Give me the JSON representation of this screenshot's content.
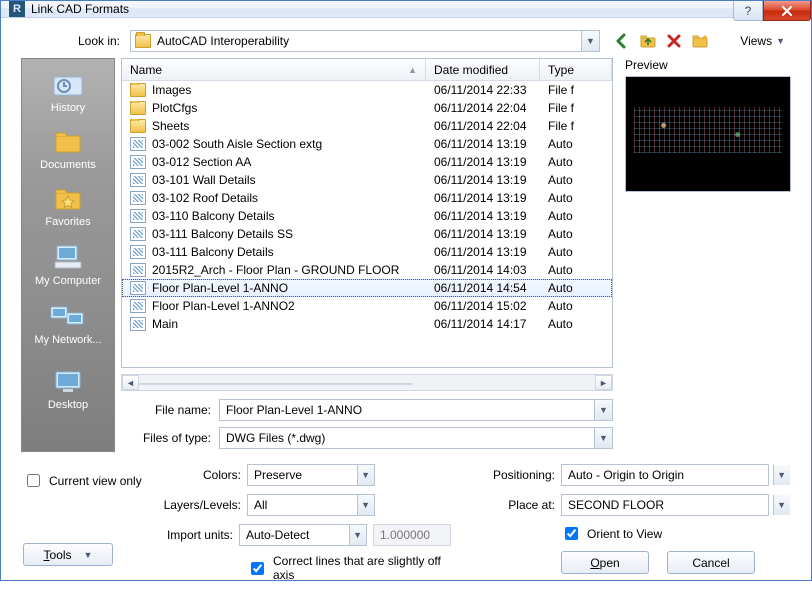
{
  "window": {
    "title": "Link CAD Formats"
  },
  "lookin": {
    "label": "Look in:",
    "value": "AutoCAD Interoperability"
  },
  "views_label": "Views",
  "columns": {
    "name": "Name",
    "date": "Date modified",
    "type": "Type"
  },
  "files": [
    {
      "icon": "folder",
      "name": "Images",
      "date": "06/11/2014 22:33",
      "type": "File f"
    },
    {
      "icon": "folder",
      "name": "PlotCfgs",
      "date": "06/11/2014 22:04",
      "type": "File f"
    },
    {
      "icon": "folder",
      "name": "Sheets",
      "date": "06/11/2014 22:04",
      "type": "File f"
    },
    {
      "icon": "dwg",
      "name": "03-002 South Aisle Section extg",
      "date": "06/11/2014 13:19",
      "type": "Auto"
    },
    {
      "icon": "dwg",
      "name": "03-012 Section AA",
      "date": "06/11/2014 13:19",
      "type": "Auto"
    },
    {
      "icon": "dwg",
      "name": "03-101 Wall Details",
      "date": "06/11/2014 13:19",
      "type": "Auto"
    },
    {
      "icon": "dwg",
      "name": "03-102 Roof Details",
      "date": "06/11/2014 13:19",
      "type": "Auto"
    },
    {
      "icon": "dwg",
      "name": "03-110 Balcony Details",
      "date": "06/11/2014 13:19",
      "type": "Auto"
    },
    {
      "icon": "dwg",
      "name": "03-111 Balcony Details SS",
      "date": "06/11/2014 13:19",
      "type": "Auto"
    },
    {
      "icon": "dwg",
      "name": "03-111 Balcony Details",
      "date": "06/11/2014 13:19",
      "type": "Auto"
    },
    {
      "icon": "dwg",
      "name": "2015R2_Arch - Floor Plan - GROUND FLOOR",
      "date": "06/11/2014 14:03",
      "type": "Auto"
    },
    {
      "icon": "dwg",
      "name": "Floor Plan-Level 1-ANNO",
      "date": "06/11/2014 14:54",
      "type": "Auto",
      "selected": true
    },
    {
      "icon": "dwg",
      "name": "Floor Plan-Level 1-ANNO2",
      "date": "06/11/2014 15:02",
      "type": "Auto"
    },
    {
      "icon": "dwg",
      "name": "Main",
      "date": "06/11/2014 14:17",
      "type": "Auto"
    }
  ],
  "places": [
    "History",
    "Documents",
    "Favorites",
    "My Computer",
    "My Network...",
    "",
    "Desktop"
  ],
  "filename": {
    "label": "File name:",
    "value": "Floor Plan-Level 1-ANNO"
  },
  "filetype": {
    "label": "Files of type:",
    "value": "DWG Files  (*.dwg)"
  },
  "preview_label": "Preview",
  "currentview": {
    "label": "Current view only",
    "checked": false
  },
  "colors": {
    "label": "Colors:",
    "value": "Preserve"
  },
  "layers": {
    "label": "Layers/Levels:",
    "value": "All"
  },
  "units": {
    "label": "Import units:",
    "value": "Auto-Detect",
    "factor": "1.000000"
  },
  "correct": {
    "label": "Correct lines that are slightly off axis",
    "checked": true
  },
  "positioning": {
    "label": "Positioning:",
    "value": "Auto - Origin to Origin"
  },
  "placeat": {
    "label": "Place at:",
    "value": "SECOND FLOOR"
  },
  "orient": {
    "label": "Orient to View",
    "checked": true
  },
  "buttons": {
    "open": "Open",
    "cancel": "Cancel",
    "tools": "Tools"
  }
}
